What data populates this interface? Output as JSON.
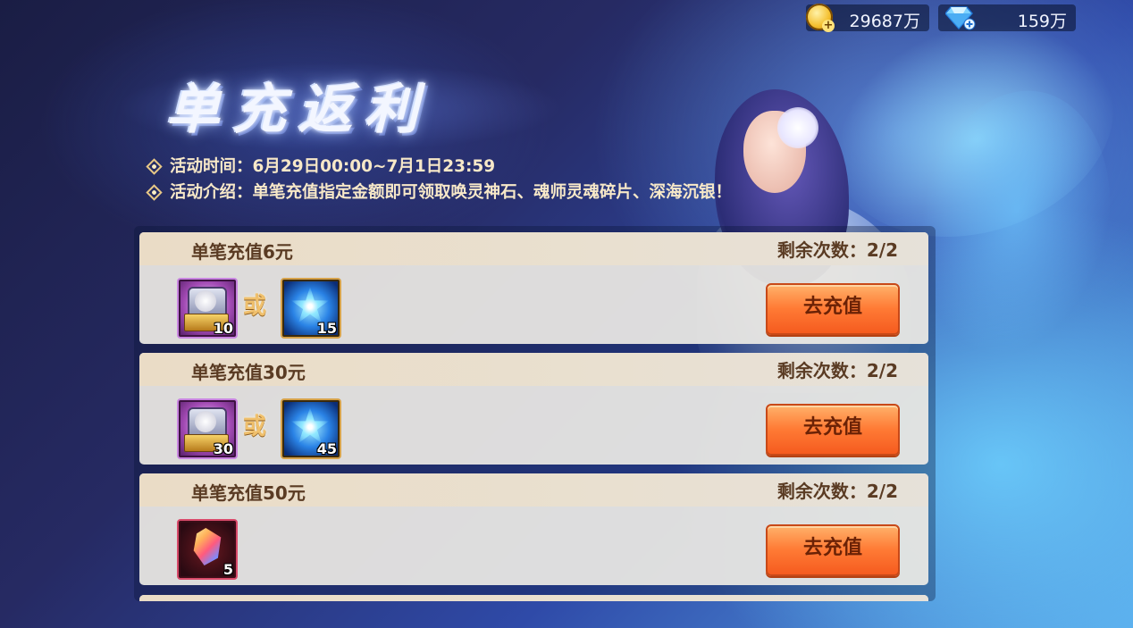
{
  "currency": {
    "gold": {
      "icon": "gold-coin-plus-icon",
      "value": "29687万"
    },
    "diamond": {
      "icon": "diamond-plus-icon",
      "value": "159万"
    }
  },
  "event": {
    "title": "单充返利",
    "time_label": "活动时间：",
    "time_value": "6月29日00:00~7月1日23:59",
    "desc_label": "活动介绍：",
    "desc_value": "单笔充值指定金额即可领取唤灵神石、魂师灵魂碎片、深海沉银！"
  },
  "tiers": [
    {
      "title": "单笔充值6元",
      "remaining": "剩余次数：2/2",
      "rewards": [
        {
          "icon": "soul-chest-icon",
          "count": "10"
        },
        {
          "icon": "blue-crystal-icon",
          "count": "15"
        }
      ],
      "or_text": "或",
      "button": "去充值"
    },
    {
      "title": "单笔充值30元",
      "remaining": "剩余次数：2/2",
      "rewards": [
        {
          "icon": "soul-chest-icon",
          "count": "30"
        },
        {
          "icon": "blue-crystal-icon",
          "count": "45"
        }
      ],
      "or_text": "或",
      "button": "去充值"
    },
    {
      "title": "单笔充值50元",
      "remaining": "剩余次数：2/2",
      "rewards": [
        {
          "icon": "rainbow-gem-icon",
          "count": "5"
        }
      ],
      "button": "去充值"
    }
  ],
  "colors": {
    "accent_button": "#ff7b35",
    "card_text": "#5a3b23",
    "info_text": "#f7e8c8"
  }
}
